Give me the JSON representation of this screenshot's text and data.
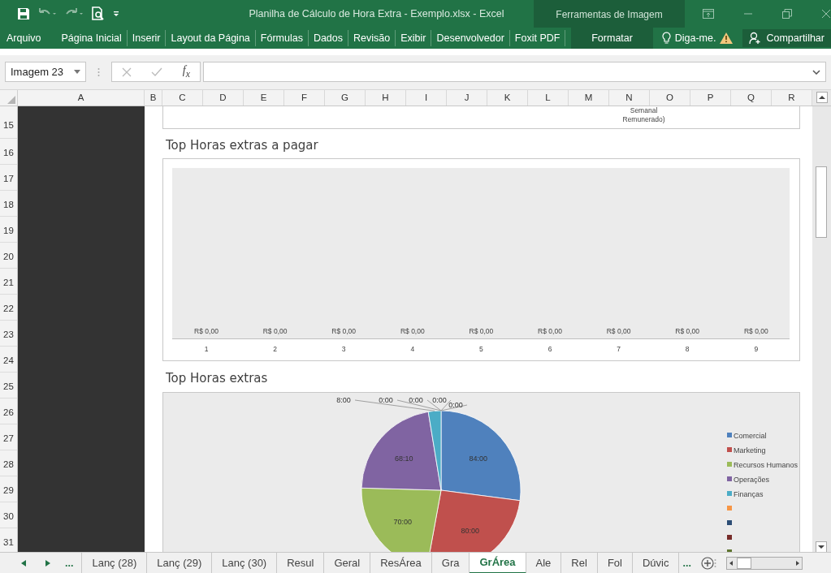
{
  "window": {
    "title": "Planilha de Cálculo de Hora Extra - Exemplo.xlsx - Excel",
    "context_title": "Ferramentas de Imagem"
  },
  "ribbon_tabs": [
    {
      "label": "Arquivo",
      "kind": "file",
      "selected": false
    },
    {
      "label": "Página Inicial",
      "kind": "tab",
      "selected": false
    },
    {
      "label": "Inserir",
      "kind": "tab",
      "selected": false
    },
    {
      "label": "Layout da Página",
      "kind": "tab",
      "selected": false
    },
    {
      "label": "Fórmulas",
      "kind": "tab",
      "selected": false
    },
    {
      "label": "Dados",
      "kind": "tab",
      "selected": false
    },
    {
      "label": "Revisão",
      "kind": "tab",
      "selected": false
    },
    {
      "label": "Exibir",
      "kind": "tab",
      "selected": false
    },
    {
      "label": "Desenvolvedor",
      "kind": "tab",
      "selected": false
    },
    {
      "label": "Foxit PDF",
      "kind": "tab",
      "selected": false
    },
    {
      "label": "Formatar",
      "kind": "context",
      "selected": false
    }
  ],
  "tell_me": "Diga-me.",
  "share": "Compartilhar",
  "formula_bar": {
    "name_box": "Imagem 23",
    "fx": "f$_{x}$"
  },
  "columns": [
    "A",
    "B",
    "C",
    "D",
    "E",
    "F",
    "G",
    "H",
    "I",
    "J",
    "K",
    "L",
    "M",
    "N",
    "O",
    "P",
    "Q",
    "R"
  ],
  "rows": [
    "15",
    "16",
    "17",
    "18",
    "19",
    "20",
    "21",
    "22",
    "23",
    "24",
    "25",
    "26",
    "27",
    "28",
    "29",
    "30",
    "31"
  ],
  "text_box": [
    "Semanal",
    "Remunerado)"
  ],
  "bar_chart": {
    "title": "Top Horas extras a pagar",
    "categories": [
      "1",
      "2",
      "3",
      "4",
      "5",
      "6",
      "7",
      "8",
      "9"
    ],
    "value_labels": [
      "R$ 0,00",
      "R$ 0,00",
      "R$ 0,00",
      "R$ 0,00",
      "R$ 0,00",
      "R$ 0,00",
      "R$ 0,00",
      "R$ 0,00",
      "R$ 0,00"
    ]
  },
  "pie_chart": {
    "chart_data": {
      "type": "pie",
      "title": "Top Horas extras",
      "categories": [
        "Comercial",
        "Marketing",
        "Recursos Humanos",
        "Operações",
        "Finanças",
        null,
        null,
        null,
        null
      ],
      "values": [
        84,
        80,
        70,
        68.1667,
        8,
        0,
        0,
        0,
        0
      ],
      "legend": "right",
      "colors": [
        "#4f81bd",
        "#c0504d",
        "#9bbb59",
        "#8064a2",
        "#4bacc6",
        "#f79646",
        "#2c4d75",
        "#772c2a",
        "#5f7530"
      ],
      "value_labels": [
        "84:00",
        "80:00",
        "70:00",
        "68:10",
        "8:00",
        "0:00",
        "0:00",
        "0:00",
        "0:00"
      ]
    }
  },
  "sheet_tabs": [
    {
      "label": "Lanç (28)",
      "selected": false
    },
    {
      "label": "Lanç (29)",
      "selected": false
    },
    {
      "label": "Lanç (30)",
      "selected": false
    },
    {
      "label": "Resul",
      "selected": false
    },
    {
      "label": "Geral",
      "selected": false
    },
    {
      "label": "ResÁrea",
      "selected": false
    },
    {
      "label": "Gra",
      "selected": false
    },
    {
      "label": "GrÁrea",
      "selected": true
    },
    {
      "label": "Ale",
      "selected": false
    },
    {
      "label": "Rel",
      "selected": false
    },
    {
      "label": "Fol",
      "selected": false
    },
    {
      "label": "Dúvic",
      "selected": false
    }
  ],
  "tabs_more_left": "...",
  "tabs_more_right": "..."
}
